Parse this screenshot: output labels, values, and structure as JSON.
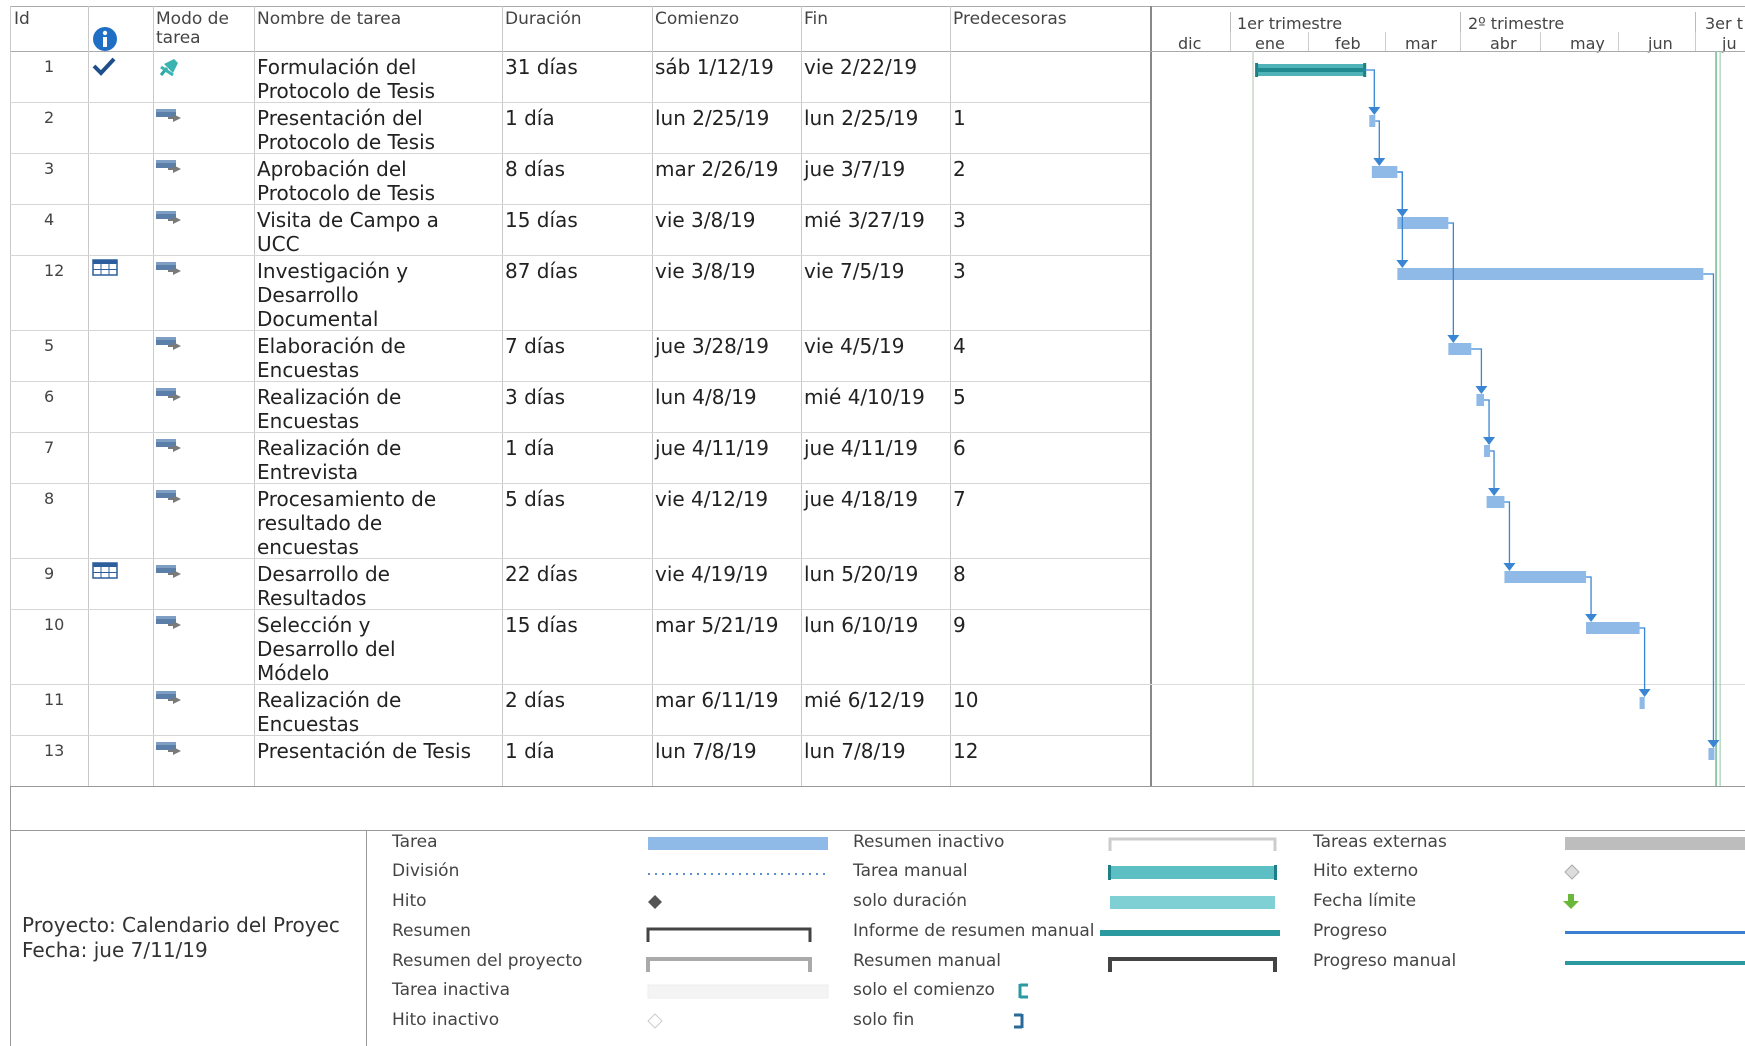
{
  "columns": {
    "id": "Id",
    "mode": "Modo de tarea",
    "name": "Nombre de tarea",
    "duration": "Duración",
    "start": "Comienzo",
    "finish": "Fin",
    "pred": "Predecesoras"
  },
  "timescale": {
    "top": [
      "1er trimestre",
      "2º trimestre",
      "3er t"
    ],
    "bottom": [
      "dic",
      "ene",
      "feb",
      "mar",
      "abr",
      "may",
      "jun",
      "ju"
    ]
  },
  "tasks": [
    {
      "id": "1",
      "name": [
        "Formulación del",
        "Protocolo de Tesis"
      ],
      "duration": "31 días",
      "start": "sáb 1/12/19",
      "finish": "vie 2/22/19",
      "pred": "",
      "indicator": "check",
      "mode": "manual"
    },
    {
      "id": "2",
      "name": [
        "Presentación del",
        "Protocolo de Tesis"
      ],
      "duration": "1 día",
      "start": "lun 2/25/19",
      "finish": "lun 2/25/19",
      "pred": "1",
      "indicator": "",
      "mode": "auto"
    },
    {
      "id": "3",
      "name": [
        "Aprobación del",
        "Protocolo de Tesis"
      ],
      "duration": "8 días",
      "start": "mar 2/26/19",
      "finish": "jue 3/7/19",
      "pred": "2",
      "indicator": "",
      "mode": "auto"
    },
    {
      "id": "4",
      "name": [
        "Visita de Campo a",
        "UCC"
      ],
      "duration": "15 días",
      "start": "vie 3/8/19",
      "finish": "mié 3/27/19",
      "pred": "3",
      "indicator": "",
      "mode": "auto"
    },
    {
      "id": "12",
      "name": [
        "Investigación y",
        "Desarrollo",
        "Documental"
      ],
      "duration": "87 días",
      "start": "vie 3/8/19",
      "finish": "vie 7/5/19",
      "pred": "3",
      "indicator": "table",
      "mode": "auto"
    },
    {
      "id": "5",
      "name": [
        "Elaboración de",
        "Encuestas"
      ],
      "duration": "7 días",
      "start": "jue 3/28/19",
      "finish": "vie 4/5/19",
      "pred": "4",
      "indicator": "",
      "mode": "auto"
    },
    {
      "id": "6",
      "name": [
        "Realización de",
        "Encuestas"
      ],
      "duration": "3 días",
      "start": "lun 4/8/19",
      "finish": "mié 4/10/19",
      "pred": "5",
      "indicator": "",
      "mode": "auto"
    },
    {
      "id": "7",
      "name": [
        "Realización de",
        "Entrevista"
      ],
      "duration": "1 día",
      "start": "jue 4/11/19",
      "finish": "jue 4/11/19",
      "pred": "6",
      "indicator": "",
      "mode": "auto"
    },
    {
      "id": "8",
      "name": [
        "Procesamiento de",
        "resultado de",
        "encuestas"
      ],
      "duration": "5 días",
      "start": "vie 4/12/19",
      "finish": "jue 4/18/19",
      "pred": "7",
      "indicator": "",
      "mode": "auto"
    },
    {
      "id": "9",
      "name": [
        "Desarrollo de",
        "Resultados"
      ],
      "duration": "22 días",
      "start": "vie 4/19/19",
      "finish": "lun 5/20/19",
      "pred": "8",
      "indicator": "table",
      "mode": "auto"
    },
    {
      "id": "10",
      "name": [
        "Selección y",
        "Desarrollo del",
        "Módelo"
      ],
      "duration": "15 días",
      "start": "mar 5/21/19",
      "finish": "lun 6/10/19",
      "pred": "9",
      "indicator": "",
      "mode": "auto"
    },
    {
      "id": "11",
      "name": [
        "Realización de",
        "Encuestas"
      ],
      "duration": "2 días",
      "start": "mar 6/11/19",
      "finish": "mié 6/12/19",
      "pred": "10",
      "indicator": "",
      "mode": "auto"
    },
    {
      "id": "13",
      "name": [
        "Presentación de Tesis"
      ],
      "duration": "1 día",
      "start": "lun 7/8/19",
      "finish": "lun 7/8/19",
      "pred": "12",
      "indicator": "",
      "mode": "auto"
    }
  ],
  "legend": [
    {
      "label": "Tarea",
      "symbol": "task"
    },
    {
      "label": "División",
      "symbol": "split"
    },
    {
      "label": "Hito",
      "symbol": "milestone"
    },
    {
      "label": "Resumen",
      "symbol": "summary"
    },
    {
      "label": "Resumen del proyecto",
      "symbol": "project-summary"
    },
    {
      "label": "Tarea inactiva",
      "symbol": "inactive-task"
    },
    {
      "label": "Hito inactivo",
      "symbol": "inactive-milestone"
    },
    {
      "label": "Resumen inactivo",
      "symbol": "inactive-summary"
    },
    {
      "label": "Tarea manual",
      "symbol": "manual-task"
    },
    {
      "label": "solo duración",
      "symbol": "duration-only"
    },
    {
      "label": "Informe de resumen manual",
      "symbol": "manual-summary-rollup"
    },
    {
      "label": "Resumen manual",
      "symbol": "manual-summary"
    },
    {
      "label": "solo el comienzo",
      "symbol": "start-only"
    },
    {
      "label": "solo fin",
      "symbol": "finish-only"
    },
    {
      "label": "Tareas externas",
      "symbol": "external-tasks"
    },
    {
      "label": "Hito externo",
      "symbol": "external-milestone"
    },
    {
      "label": "Fecha límite",
      "symbol": "deadline"
    },
    {
      "label": "Progreso",
      "symbol": "progress"
    },
    {
      "label": "Progreso manual",
      "symbol": "manual-progress"
    }
  ],
  "project": {
    "name": "Proyecto: Calendario del Proyec",
    "date": "Fecha: jue 7/11/19"
  },
  "colors": {
    "task": "#8fb9e6",
    "manual": "#4fb3b8",
    "link": "#3a86d4",
    "grid": "#c9c9c9"
  },
  "chart_data": {
    "type": "gantt",
    "x_axis": {
      "start": "2018-12-01",
      "end": "2019-07-12",
      "unit": "date"
    },
    "series": [
      {
        "id": "1",
        "start": "2019-01-12",
        "end": "2019-02-22",
        "manual": true
      },
      {
        "id": "2",
        "start": "2019-02-25",
        "end": "2019-02-25"
      },
      {
        "id": "3",
        "start": "2019-02-26",
        "end": "2019-03-07"
      },
      {
        "id": "4",
        "start": "2019-03-08",
        "end": "2019-03-27"
      },
      {
        "id": "12",
        "start": "2019-03-08",
        "end": "2019-07-05"
      },
      {
        "id": "5",
        "start": "2019-03-28",
        "end": "2019-04-05"
      },
      {
        "id": "6",
        "start": "2019-04-08",
        "end": "2019-04-10"
      },
      {
        "id": "7",
        "start": "2019-04-11",
        "end": "2019-04-11"
      },
      {
        "id": "8",
        "start": "2019-04-12",
        "end": "2019-04-18"
      },
      {
        "id": "9",
        "start": "2019-04-19",
        "end": "2019-05-20"
      },
      {
        "id": "10",
        "start": "2019-05-21",
        "end": "2019-06-10"
      },
      {
        "id": "11",
        "start": "2019-06-11",
        "end": "2019-06-12"
      },
      {
        "id": "13",
        "start": "2019-07-08",
        "end": "2019-07-08"
      }
    ],
    "links": [
      [
        "1",
        "2"
      ],
      [
        "2",
        "3"
      ],
      [
        "3",
        "4"
      ],
      [
        "3",
        "12"
      ],
      [
        "4",
        "5"
      ],
      [
        "5",
        "6"
      ],
      [
        "6",
        "7"
      ],
      [
        "7",
        "8"
      ],
      [
        "8",
        "9"
      ],
      [
        "9",
        "10"
      ],
      [
        "10",
        "11"
      ],
      [
        "12",
        "13"
      ]
    ],
    "status_date": "2019-07-11"
  }
}
